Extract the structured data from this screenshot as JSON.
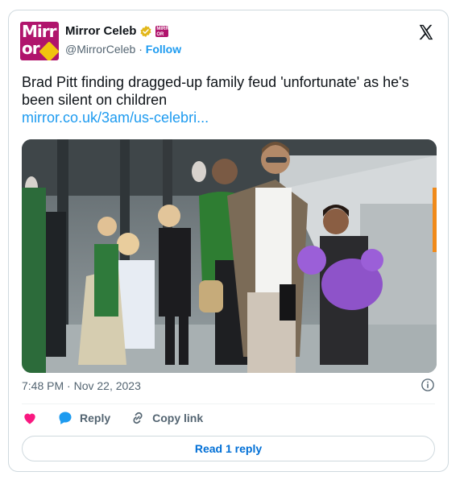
{
  "account": {
    "name": "Mirror Celeb",
    "handle": "@MirrorCeleb",
    "separator": "·",
    "follow_label": "Follow",
    "avatar_line1": "Mirr",
    "avatar_line2": "or",
    "mini_logo_text": "MIRR OR"
  },
  "tweet": {
    "text": "Brad Pitt finding dragged-up family feud 'unfortunate' as he's been silent on children",
    "link_text": "mirror.co.uk/3am/us-celebri...",
    "timestamp": "7:48 PM · Nov 22, 2023"
  },
  "actions": {
    "reply_label": "Reply",
    "copy_link_label": "Copy link",
    "read_replies_label": "Read 1 reply"
  },
  "icons": {
    "verified": "verified-badge-icon",
    "x_logo": "x-logo-icon",
    "info": "info-icon",
    "heart": "heart-icon",
    "reply": "reply-bubble-icon",
    "link": "link-icon"
  },
  "colors": {
    "accent": "#1d9bf0",
    "brand": "#b0146c",
    "heart": "#f91880",
    "read_button_text": "#006fd6"
  }
}
